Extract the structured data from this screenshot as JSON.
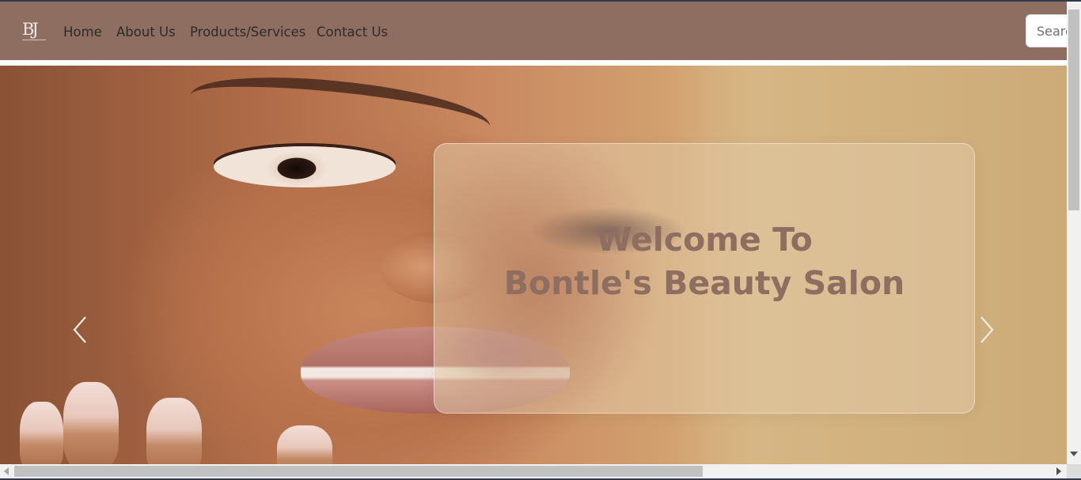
{
  "logo": {
    "letters": "BJ"
  },
  "nav": {
    "links": [
      {
        "label": "Home"
      },
      {
        "label": "About Us"
      },
      {
        "label": "Products/Services"
      },
      {
        "label": "Contact Us"
      }
    ],
    "search_placeholder": "Search"
  },
  "hero": {
    "title_line1": "Welcome To",
    "title_line2": "Bontle's Beauty Salon",
    "prev_icon": "chevron-left-icon",
    "next_icon": "chevron-right-icon"
  },
  "colors": {
    "navbar": "#8d6e60",
    "title": "#8d6e60",
    "nav_text": "#2d2b2a"
  }
}
